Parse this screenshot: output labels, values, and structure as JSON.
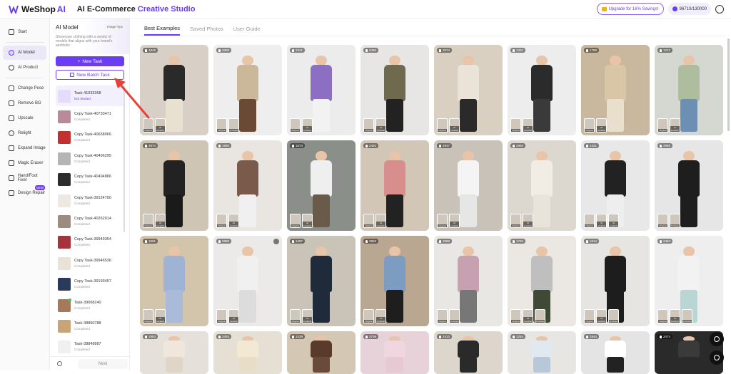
{
  "header": {
    "logo_text": "WeShop",
    "logo_suffix": "AI",
    "title_main": "AI E-Commerce",
    "title_accent": "Creative Studio",
    "upgrade_label": "Upgrade for 16% Savings!",
    "credits": "96710/130000"
  },
  "nav": {
    "items": [
      {
        "label": "Start"
      },
      {
        "label": "AI Model"
      },
      {
        "label": "AI Product"
      },
      {
        "label": "Change Pose"
      },
      {
        "label": "Remove BG"
      },
      {
        "label": "Upscale"
      },
      {
        "label": "Relight"
      },
      {
        "label": "Expand Image"
      },
      {
        "label": "Magic Eraser"
      },
      {
        "label": "Hand/Foot Fixer"
      },
      {
        "label": "Design Repair"
      }
    ],
    "new_badge": "NEW"
  },
  "panel": {
    "title": "AI Model",
    "image_tips": "Image Tips",
    "description": "Showcase clothing with a variety of models that aligns with your brand's aesthetic.",
    "new_task_label": "New Task",
    "new_batch_label": "New Batch Task",
    "next_label": "Next",
    "tasks": [
      {
        "name": "Task-41033368",
        "status": "Not Started"
      },
      {
        "name": "Copy Task-40733471",
        "status": "Completed"
      },
      {
        "name": "Copy Task-40658066",
        "status": "Completed"
      },
      {
        "name": "Copy Task-40496295",
        "status": "Completed"
      },
      {
        "name": "Copy Task-40494886",
        "status": "Completed"
      },
      {
        "name": "Copy Task-39124700",
        "status": "Completed"
      },
      {
        "name": "Copy Task-40262014",
        "status": "Completed"
      },
      {
        "name": "Copy Task-39949354",
        "status": "Completed"
      },
      {
        "name": "Copy Task-39946536",
        "status": "Completed"
      },
      {
        "name": "Copy Task-39193457",
        "status": "Completed"
      },
      {
        "name": "Task-39068240",
        "status": "Completed"
      },
      {
        "name": "Task-38850788",
        "status": "Completed"
      },
      {
        "name": "Task-38849887",
        "status": "Completed"
      }
    ]
  },
  "main": {
    "tabs": [
      {
        "label": "Best Examples"
      },
      {
        "label": "Saved Photos"
      },
      {
        "label": "User Guide"
      }
    ],
    "mini_labels": {
      "original": "Original",
      "ai_location": "AI Location",
      "ai_model": "AI Model"
    },
    "cards": [
      {
        "views": "1845",
        "bg": "#d8d0c6",
        "top": "#2a2a2a",
        "bottom": "#e8e0d0"
      },
      {
        "views": "2689",
        "bg": "#eeeeee",
        "top": "#cbb89a",
        "bottom": "#6a4a35"
      },
      {
        "views": "2341",
        "bg": "#ececec",
        "top": "#8c6fc2",
        "bottom": "#f2f2f2"
      },
      {
        "views": "2460",
        "bg": "#e8e6e4",
        "top": "#6f6a4e",
        "bottom": "#222222"
      },
      {
        "views": "2874",
        "bg": "#d9d0c2",
        "top": "#eae4d8",
        "bottom": "#2a2a2a"
      },
      {
        "views": "1334",
        "bg": "#ededed",
        "top": "#2b2b2b",
        "bottom": "#3a3a3a"
      },
      {
        "views": "1798",
        "bg": "#c9b89e",
        "top": "#d8c6a6",
        "bottom": "#eadfcc"
      },
      {
        "views": "1221",
        "bg": "#d5d8d0",
        "top": "#aebd9e",
        "bottom": "#6d8fb4"
      },
      {
        "views": "2974",
        "bg": "#cfc5b4",
        "top": "#222222",
        "bottom": "#1a1a1a"
      },
      {
        "views": "1996",
        "bg": "#e9e6e1",
        "top": "#7a5a4a",
        "bottom": "#f0f0f0"
      },
      {
        "views": "1674",
        "bg": "#8b8f8a",
        "top": "#efefef",
        "bottom": "#6a5a4a"
      },
      {
        "views": "2492",
        "bg": "#d2c6b6",
        "top": "#d98e8e",
        "bottom": "#222222"
      },
      {
        "views": "2947",
        "bg": "#c8c2b8",
        "top": "#f4f4f4",
        "bottom": "#e6e6e6"
      },
      {
        "views": "2956",
        "bg": "#ddd8cf",
        "top": "#f1ede4",
        "bottom": "#e9e4da"
      },
      {
        "views": "1421",
        "bg": "#e8e8e8",
        "top": "#222222",
        "bottom": "#eeeeee"
      },
      {
        "views": "2989",
        "bg": "#e6e6e6",
        "top": "#1e1e1e",
        "bottom": "#1e1e1e"
      },
      {
        "views": "1691",
        "bg": "#d3c4ac",
        "top": "#9fb3d4",
        "bottom": "#a9bbd8"
      },
      {
        "views": "2889",
        "bg": "#ebeae8",
        "top": "#f0f0f0",
        "bottom": "#dcdcdc"
      },
      {
        "views": "1297",
        "bg": "#c9c3b8",
        "top": "#1f2a3a",
        "bottom": "#1f2a3a"
      },
      {
        "views": "2863",
        "bg": "#b9a792",
        "top": "#7c9cc2",
        "bottom": "#1e1e1e"
      },
      {
        "views": "2989",
        "bg": "#e9e7e4",
        "top": "#c7a1b0",
        "bottom": "#777777"
      },
      {
        "views": "1793",
        "bg": "#ebe8e4",
        "top": "#bfbfbf",
        "bottom": "#3f4a36"
      },
      {
        "views": "1514",
        "bg": "#e7e5e2",
        "top": "#1d1d1d",
        "bottom": "#1d1d1d"
      },
      {
        "views": "2493",
        "bg": "#eeeeee",
        "top": "#f2f2f2",
        "bottom": "#b9d6d4"
      },
      {
        "views": "2983",
        "bg": "#e5e1da",
        "top": "#f0e6dc",
        "bottom": "#e0d6c8"
      },
      {
        "views": "2493",
        "bg": "#e6e0d4",
        "top": "#f2e8d4",
        "bottom": "#e8ddc7"
      },
      {
        "views": "1439",
        "bg": "#d4c8b4",
        "top": "#5a3a2a",
        "bottom": "#6a4a3a"
      },
      {
        "views": "2706",
        "bg": "#e6d2d8",
        "top": "#f0d6df",
        "bottom": "#e6c9d2"
      },
      {
        "views": "2413",
        "bg": "#ddd6cc",
        "top": "#2a2a2a",
        "bottom": "#2a2a2a"
      },
      {
        "views": "1284",
        "bg": "#e8e6e2",
        "top": "#e0e8f0",
        "bottom": "#b8c8d8"
      },
      {
        "views": "2944",
        "bg": "#e4e4e4",
        "top": "#ffffff",
        "bottom": "#222222"
      },
      {
        "views": "2474",
        "bg": "#2a2a2a",
        "top": "#3a3a3a",
        "bottom": "#2a2a2a"
      }
    ]
  },
  "colors": {
    "accent": "#6a3df5",
    "arrow": "#e8403a"
  },
  "icons": [
    "logo-icon",
    "crown-icon",
    "coin-icon",
    "user-icon",
    "search-icon",
    "fire-icon",
    "play-icon",
    "lightbulb-icon",
    "headset-icon"
  ]
}
